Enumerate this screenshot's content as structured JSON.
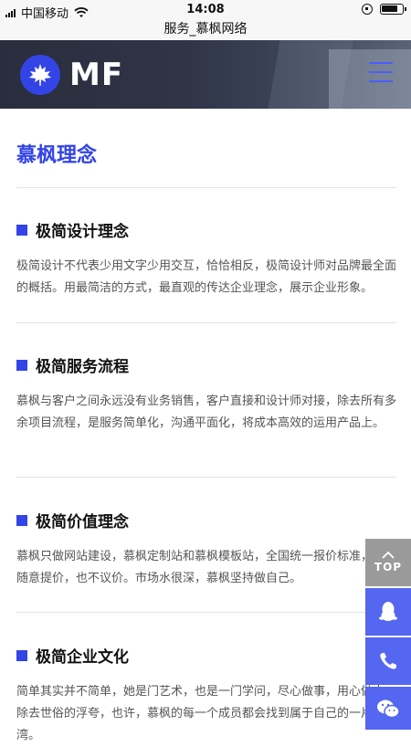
{
  "status_bar": {
    "carrier": "中国移动",
    "time": "14:08",
    "page_title": "服务_慕枫网络"
  },
  "header": {
    "logo_text": "MF",
    "logo_icon": "maple-leaf-icon",
    "menu_icon": "hamburger-menu-icon"
  },
  "main": {
    "section_title": "慕枫理念",
    "cards": [
      {
        "title": "极简设计理念",
        "body": "极简设计不代表少用文字少用交互，恰恰相反，极简设计师对品牌最全面的概括。用最简洁的方式，最直观的传达企业理念，展示企业形象。"
      },
      {
        "title": "极简服务流程",
        "body": "慕枫与客户之间永远没有业务销售，客户直接和设计师对接，除去所有多余项目流程，是服务简单化，沟通平面化，将成本高效的运用产品上。"
      },
      {
        "title": "极简价值理念",
        "body": "慕枫只做网站建设，慕枫定制站和慕枫模板站，全国统一报价标准，决不随意提价，也不议价。市场水很深，慕枫坚持做自己。"
      },
      {
        "title": "极简企业文化",
        "body": "简单其实并不简单，她是门艺术，也是一门学问，尽心做事，用心做人，除去世俗的浮夸，也许，慕枫的每一个成员都会找到属于自己的一片港湾。"
      }
    ]
  },
  "side_buttons": {
    "top_label": "TOP",
    "qq_icon": "qq-penguin-icon",
    "phone_icon": "phone-icon",
    "wechat_icon": "wechat-icon"
  },
  "colors": {
    "accent": "#3344e6",
    "side_button": "#5566f0",
    "top_button": "#9a9a9a",
    "header_dark": "#2a2d3d"
  }
}
